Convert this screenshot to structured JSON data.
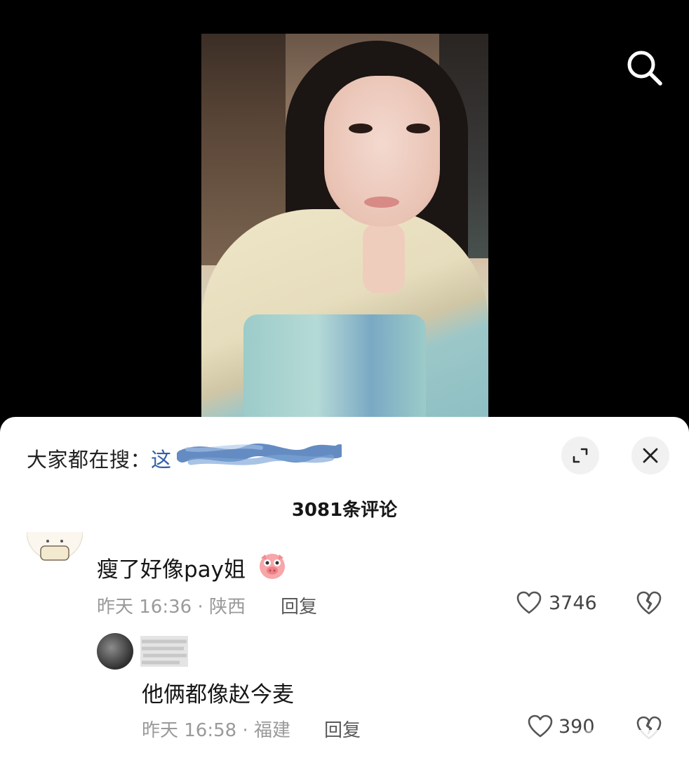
{
  "video": {
    "search_icon": "search-icon"
  },
  "panel": {
    "trending_label": "大家都在搜：",
    "trending_term_visible": "这",
    "comment_count": "3081条评论",
    "icons": {
      "expand": "expand-icon",
      "close": "close-icon"
    }
  },
  "comments": [
    {
      "text": "瘦了好像pay姐",
      "emoji": "pig-face",
      "meta": "昨天 16:36 · 陕西",
      "reply": "回复",
      "likes": "3746"
    },
    {
      "text": "他俩都像赵今麦",
      "meta": "昨天 16:58 · 福建",
      "reply": "回复",
      "likes": "390"
    }
  ],
  "colors": {
    "trending_link": "#2f5fa8",
    "meta_gray": "#9a9a9a",
    "panel_bg": "#ffffff"
  }
}
